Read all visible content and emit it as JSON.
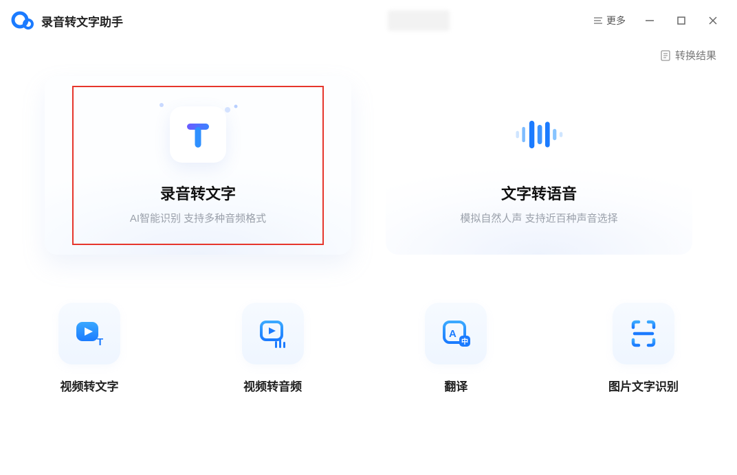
{
  "app": {
    "title": "录音转文字助手"
  },
  "titlebar": {
    "more": "更多"
  },
  "results_link": "转换结果",
  "cards": {
    "audio_to_text": {
      "title": "录音转文字",
      "subtitle": "AI智能识别 支持多种音频格式"
    },
    "text_to_speech": {
      "title": "文字转语音",
      "subtitle": "模拟自然人声 支持近百种声音选择"
    }
  },
  "small_cards": {
    "video_to_text": "视频转文字",
    "video_to_audio": "视频转音频",
    "translate": "翻译",
    "image_ocr": "图片文字识别"
  }
}
